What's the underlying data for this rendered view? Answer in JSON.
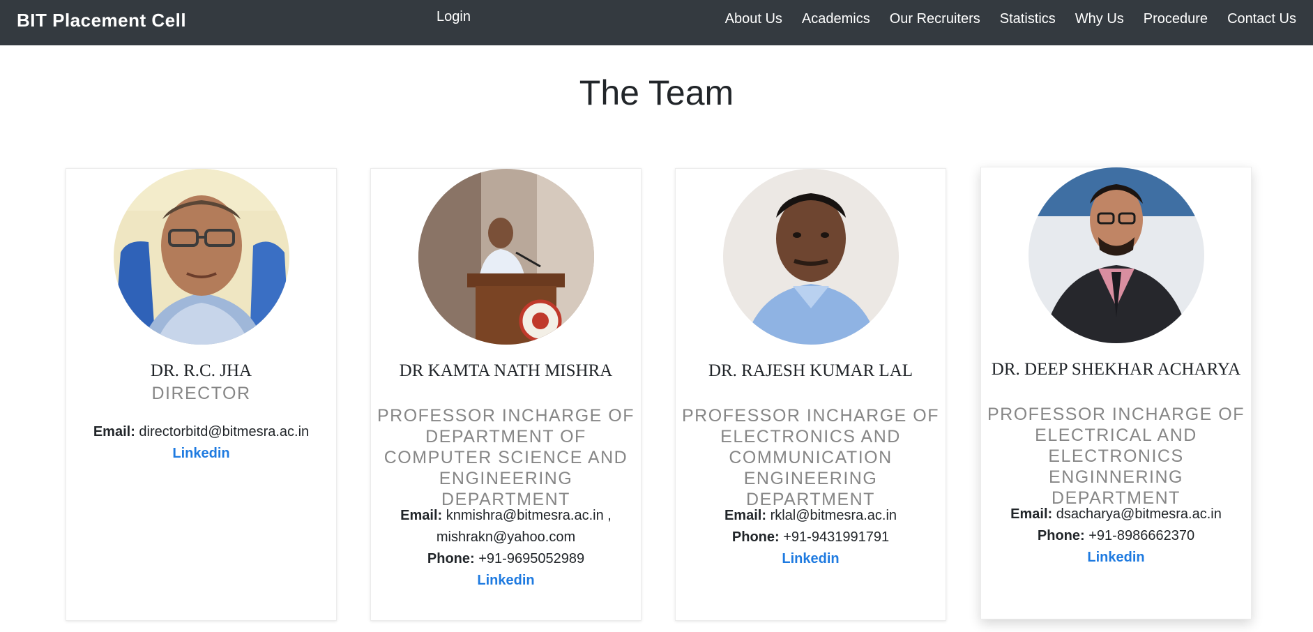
{
  "navbar": {
    "brand": "BIT Placement Cell",
    "login": "Login",
    "links": [
      "About Us",
      "Academics",
      "Our Recruiters",
      "Statistics",
      "Why Us",
      "Procedure",
      "Contact Us"
    ]
  },
  "page": {
    "title": "The Team"
  },
  "team": [
    {
      "name": "DR. R.C. JHA",
      "role": "DIRECTOR",
      "email_label": "Email:",
      "email": "directorbitd@bitmesra.ac.in",
      "linkedin": "Linkedin"
    },
    {
      "name": "DR KAMTA NATH MISHRA",
      "role": "PROFESSOR INCHARGE OF DEPARTMENT OF COMPUTER SCIENCE AND ENGINEERING DEPARTMENT",
      "email_label": "Email:",
      "email": "knmishra@bitmesra.ac.in , mishrakn@yahoo.com",
      "phone_label": "Phone:",
      "phone": "+91-9695052989",
      "linkedin": "Linkedin"
    },
    {
      "name": "DR. RAJESH KUMAR LAL",
      "role": "PROFESSOR INCHARGE OF ELECTRONICS AND COMMUNICATION ENGINEERING DEPARTMENT",
      "email_label": "Email:",
      "email": "rklal@bitmesra.ac.in",
      "phone_label": "Phone:",
      "phone": "+91-9431991791",
      "linkedin": "Linkedin"
    },
    {
      "name": "DR. DEEP SHEKHAR ACHARYA",
      "role": "PROFESSOR INCHARGE OF ELECTRICAL AND ELECTRONICS ENGINNERING DEPARTMENT",
      "email_label": "Email:",
      "email": "dsacharya@bitmesra.ac.in",
      "phone_label": "Phone:",
      "phone": "+91-8986662370",
      "linkedin": "Linkedin"
    }
  ],
  "colors": {
    "navbar_bg": "#343a40",
    "link_blue": "#1e7ae0",
    "role_gray": "#868686"
  }
}
